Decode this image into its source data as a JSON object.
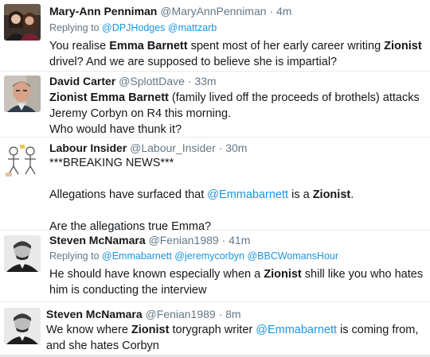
{
  "tweets": [
    {
      "name": "Mary-Ann Penniman",
      "handle": "@MaryAnnPenniman",
      "sep": "·",
      "time": "4m",
      "reply_prefix": "Replying to",
      "reply_to": [
        "@DPJHodges",
        "@mattzarb"
      ],
      "text": [
        {
          "t": "You realise "
        },
        {
          "t": "Emma Barnett",
          "b": true
        },
        {
          "t": " spent most of her early career writing "
        },
        {
          "t": "Zionist",
          "b": true
        },
        {
          "t": " drivel? And we are supposed to believe she is impartial?"
        }
      ]
    },
    {
      "name": "David Carter",
      "handle": "@SplottDave",
      "sep": "·",
      "time": "33m",
      "text": [
        {
          "t": "Zionist Emma Barnett",
          "b": true
        },
        {
          "t": " (family lived off the proceeds of brothels) attacks Jeremy Corbyn on R4 this morning."
        },
        {
          "br": true
        },
        {
          "t": "Who would have thunk it?"
        }
      ]
    },
    {
      "name": "Labour Insider",
      "handle": "@Labour_Insider",
      "sep": "·",
      "time": "30m",
      "text": [
        {
          "t": "***BREAKING NEWS***"
        },
        {
          "gap": true
        },
        {
          "t": "Allegations have surfaced that "
        },
        {
          "t": "@Emmabarnett",
          "mention": true
        },
        {
          "t": " is a "
        },
        {
          "t": "Zionist",
          "b": true
        },
        {
          "t": "."
        },
        {
          "gap": true
        },
        {
          "t": "Are the allegations true Emma?"
        }
      ]
    },
    {
      "name": "Steven McNamara",
      "handle": "@Fenian1989",
      "sep": "·",
      "time": "41m",
      "reply_prefix": "Replying to",
      "reply_to": [
        "@Emmabarnett",
        "@jeremycorbyn",
        "@BBCWomansHour"
      ],
      "text": [
        {
          "t": "He should have known especially when a "
        },
        {
          "t": "Zionist",
          "b": true
        },
        {
          "t": " shill like you who hates him is conducting the interview"
        }
      ]
    },
    {
      "name": "Steven McNamara",
      "handle": "@Fenian1989",
      "sep": "·",
      "time": "8m",
      "text": [
        {
          "t": "We know where "
        },
        {
          "t": "Zionist",
          "b": true
        },
        {
          "t": " torygraph writer "
        },
        {
          "t": "@Emmabarnett",
          "mention": true
        },
        {
          "t": " is coming from, and she hates Corbyn"
        }
      ]
    }
  ],
  "colors": {
    "link": "#1b95e0",
    "secondary": "#657786",
    "text": "#14171a",
    "divider": "#e6ecf0"
  },
  "icons": [
    "avatar-photo-couple",
    "avatar-photo-man",
    "avatar-stick-figures",
    "avatar-photo-vintage-portrait",
    "avatar-photo-vintage-portrait"
  ]
}
